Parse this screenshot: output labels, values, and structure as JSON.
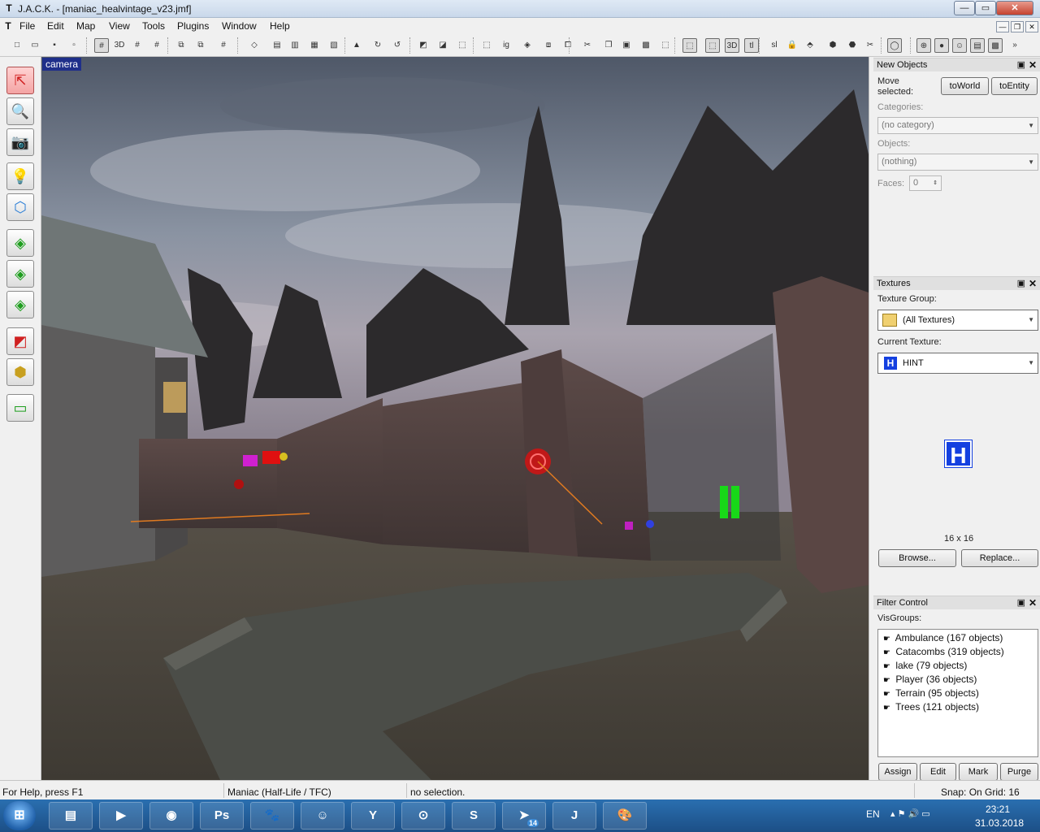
{
  "window": {
    "title": "J.A.C.K. - [maniac_healvintage_v23.jmf]",
    "minimize_glyph": "—",
    "maximize_glyph": "▭",
    "close_glyph": "✕"
  },
  "menu": {
    "items": [
      "File",
      "Edit",
      "Map",
      "View",
      "Tools",
      "Plugins",
      "Window",
      "Help"
    ],
    "mdi_buttons": [
      "—",
      "❐",
      "✕"
    ]
  },
  "toolbar": {
    "icons": [
      {
        "name": "new-icon",
        "glyph": "□"
      },
      {
        "name": "open-icon",
        "glyph": "▭"
      },
      {
        "name": "save-icon",
        "glyph": "▪"
      },
      {
        "name": "save-as-icon",
        "glyph": "▫"
      },
      {
        "name": "grid-2d-icon",
        "glyph": "#"
      },
      {
        "name": "grid-3d-icon",
        "glyph": "3D"
      },
      {
        "name": "grid-smaller-icon",
        "glyph": "#"
      },
      {
        "name": "grid-larger-icon",
        "glyph": "#"
      },
      {
        "name": "load-window-state-icon",
        "glyph": "⧉"
      },
      {
        "name": "save-window-state-icon",
        "glyph": "⧉"
      },
      {
        "name": "toggle-grid-icon",
        "glyph": "#"
      },
      {
        "name": "vertex-icon",
        "glyph": "◇"
      },
      {
        "name": "align-icon",
        "glyph": "▤"
      },
      {
        "name": "align-2-icon",
        "glyph": "▥"
      },
      {
        "name": "align-3-icon",
        "glyph": "▦"
      },
      {
        "name": "align-4-icon",
        "glyph": "▧"
      },
      {
        "name": "flip-icon",
        "glyph": "▲"
      },
      {
        "name": "rotate-icon",
        "glyph": "↻"
      },
      {
        "name": "rotate-2-icon",
        "glyph": "↺"
      },
      {
        "name": "carve-icon",
        "glyph": "◩"
      },
      {
        "name": "hollow-icon",
        "glyph": "◪"
      },
      {
        "name": "group-icon",
        "glyph": "⬚"
      },
      {
        "name": "ungroup-icon",
        "glyph": "⬚"
      },
      {
        "name": "ig-icon",
        "glyph": "ig"
      },
      {
        "name": "tie-icon",
        "glyph": "◈"
      },
      {
        "name": "move-icon",
        "glyph": "⧈"
      },
      {
        "name": "copy-icon",
        "glyph": "⧠"
      },
      {
        "name": "cut-icon",
        "glyph": "✂"
      },
      {
        "name": "clone-icon",
        "glyph": "❐"
      },
      {
        "name": "paste-icon",
        "glyph": "▣"
      },
      {
        "name": "texture-lock-icon",
        "glyph": "▩"
      },
      {
        "name": "selection-box-icon",
        "glyph": "⬚"
      },
      {
        "name": "view-2d-icon",
        "glyph": "⬚"
      },
      {
        "name": "view-wire-icon",
        "glyph": "⬚"
      },
      {
        "name": "view-3d-icon",
        "glyph": "3D"
      },
      {
        "name": "tl-icon",
        "glyph": "tl"
      },
      {
        "name": "sl-icon",
        "glyph": "sl"
      },
      {
        "name": "lock-icon",
        "glyph": "🔒"
      },
      {
        "name": "entity-report-icon",
        "glyph": "⬘"
      },
      {
        "name": "run-icon",
        "glyph": "⬢"
      },
      {
        "name": "compile-icon",
        "glyph": "⬣"
      },
      {
        "name": "tools-icon",
        "glyph": "✂"
      },
      {
        "name": "view-mode-1-icon",
        "glyph": "◯"
      },
      {
        "name": "view-mode-2-icon",
        "glyph": "⊕"
      },
      {
        "name": "view-mode-3-icon",
        "glyph": "●"
      },
      {
        "name": "view-mode-4-icon",
        "glyph": "☺"
      },
      {
        "name": "view-mode-5-icon",
        "glyph": "▤"
      },
      {
        "name": "view-mode-6-icon",
        "glyph": "▩"
      },
      {
        "name": "more-icon",
        "glyph": "»"
      }
    ]
  },
  "left_tools": [
    {
      "name": "selection-tool-icon",
      "glyph": "⇱",
      "color": "#d02020"
    },
    {
      "name": "magnify-tool-icon",
      "glyph": "🔍",
      "color": "#d02020"
    },
    {
      "name": "camera-tool-icon",
      "glyph": "📷",
      "color": "#d02020"
    },
    {
      "name": "entity-tool-icon",
      "glyph": "💡",
      "color": "#2d7fd6"
    },
    {
      "name": "block-tool-icon",
      "glyph": "⬡",
      "color": "#2d7fd6"
    },
    {
      "name": "texture-app-icon",
      "glyph": "◈",
      "color": "#1e9e1e"
    },
    {
      "name": "apply-texture-icon",
      "glyph": "◈",
      "color": "#1e9e1e"
    },
    {
      "name": "decal-tool-icon",
      "glyph": "◈",
      "color": "#1e9e1e"
    },
    {
      "name": "clip-tool-icon",
      "glyph": "◩",
      "color": "#d02020"
    },
    {
      "name": "vertex-tool-icon",
      "glyph": "⬢",
      "color": "#c8a020"
    },
    {
      "name": "path-tool-icon",
      "glyph": "▭",
      "color": "#1e9e1e"
    }
  ],
  "viewport": {
    "label": "camera"
  },
  "new_objects": {
    "title": "New Objects",
    "pin_glyph": "▣",
    "close_glyph": "✕",
    "move_selected_label_1": "Move",
    "move_selected_label_2": "selected:",
    "to_world": "toWorld",
    "to_entity": "toEntity",
    "categories_label": "Categories:",
    "category_value": "(no category)",
    "objects_label": "Objects:",
    "objects_value": "(nothing)",
    "faces_label": "Faces:",
    "faces_value": "0"
  },
  "textures": {
    "title": "Textures",
    "pin_glyph": "▣",
    "close_glyph": "✕",
    "group_label": "Texture Group:",
    "group_value": "(All Textures)",
    "current_label": "Current Texture:",
    "current_value": "HINT",
    "preview_letter": "H",
    "size": "16 x 16",
    "browse": "Browse...",
    "replace": "Replace..."
  },
  "filter_control": {
    "title": "Filter Control",
    "pin_glyph": "▣",
    "close_glyph": "✕",
    "visgroups_label": "VisGroups:",
    "groups": [
      "Ambulance (167 objects)",
      "Catacombs (319 objects)",
      "lake (79 objects)",
      "Player (36 objects)",
      "Terrain (95 objects)",
      "Trees (121 objects)"
    ],
    "assign": "Assign",
    "edit": "Edit",
    "mark": "Mark",
    "purge": "Purge"
  },
  "status": {
    "help": "For Help, press F1",
    "game": "Maniac (Half-Life / TFC)",
    "selection": "no selection.",
    "snap": "Snap: On Grid: 16"
  },
  "taskbar": {
    "start_glyph": "⊞",
    "apps": [
      {
        "name": "explorer-icon",
        "glyph": "▤"
      },
      {
        "name": "media-player-icon",
        "glyph": "▶"
      },
      {
        "name": "chrome-icon",
        "glyph": "◉"
      },
      {
        "name": "photoshop-icon",
        "glyph": "Ps"
      },
      {
        "name": "gimp-icon",
        "glyph": "🐾"
      },
      {
        "name": "kakaotalk-icon",
        "glyph": "☺"
      },
      {
        "name": "yandex-browser-icon",
        "glyph": "Y"
      },
      {
        "name": "steam-icon",
        "glyph": "⊙"
      },
      {
        "name": "skype-icon",
        "glyph": "S"
      },
      {
        "name": "telegram-icon",
        "glyph": "➤"
      },
      {
        "name": "jack-editor-icon",
        "glyph": "J"
      },
      {
        "name": "paint-icon",
        "glyph": "🎨"
      }
    ],
    "telegram_badge": "14",
    "language": "EN",
    "tray_icons": "▴ ⚑ 🔊 ▭",
    "time": "23:21",
    "date": "31.03.2018"
  }
}
